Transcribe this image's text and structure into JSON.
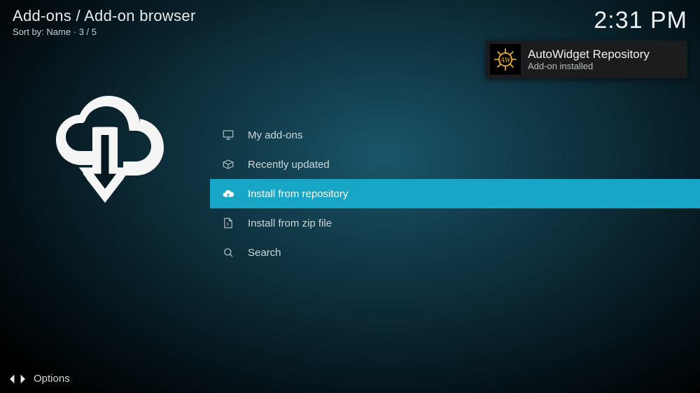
{
  "header": {
    "breadcrumb": "Add-ons / Add-on browser",
    "sort_label": "Sort by:",
    "sort_value": "Name",
    "position": "3 / 5",
    "clock": "2:31 PM"
  },
  "notification": {
    "title": "AutoWidget Repository",
    "message": "Add-on installed",
    "icon_name": "autowidget-gear-icon"
  },
  "menu": {
    "selected_index": 2,
    "items": [
      {
        "icon": "monitor-icon",
        "label": "My add-ons"
      },
      {
        "icon": "open-box-icon",
        "label": "Recently updated"
      },
      {
        "icon": "cloud-download-icon",
        "label": "Install from repository"
      },
      {
        "icon": "zip-file-icon",
        "label": "Install from zip file"
      },
      {
        "icon": "search-icon",
        "label": "Search"
      }
    ]
  },
  "footer": {
    "options_label": "Options"
  }
}
